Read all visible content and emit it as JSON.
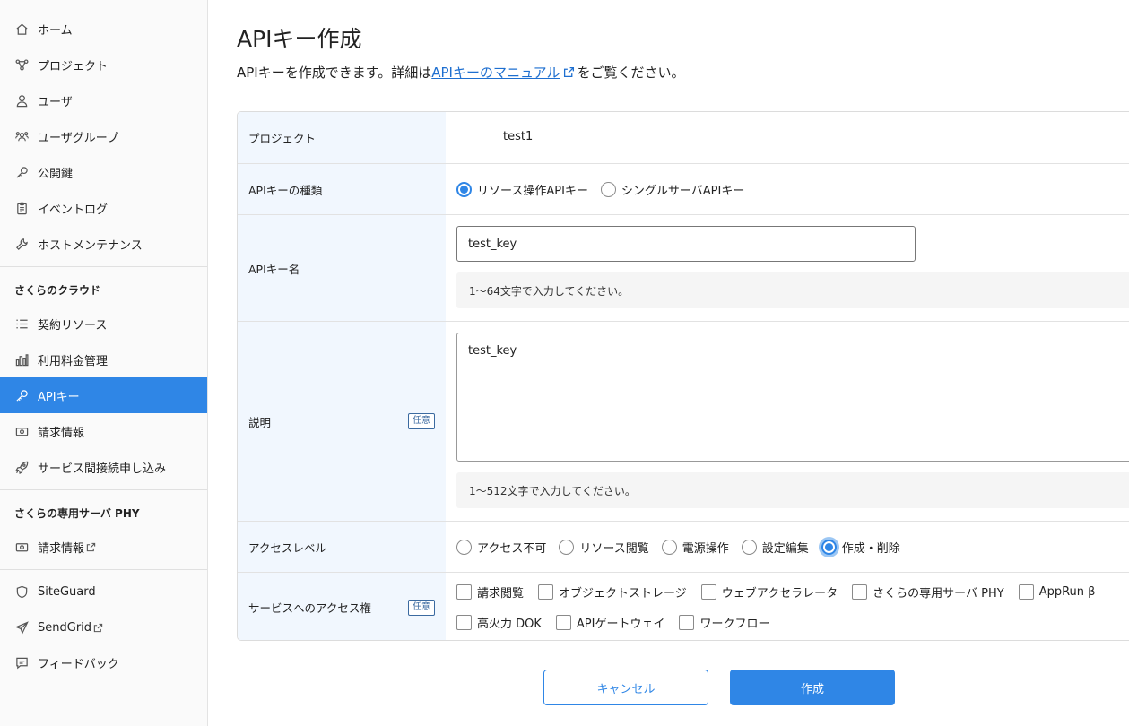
{
  "sidebar": {
    "items": [
      {
        "label": "ホーム",
        "icon": "home-icon"
      },
      {
        "label": "プロジェクト",
        "icon": "project-icon"
      },
      {
        "label": "ユーザ",
        "icon": "user-icon"
      },
      {
        "label": "ユーザグループ",
        "icon": "user-group-icon"
      },
      {
        "label": "公開鍵",
        "icon": "key-icon"
      },
      {
        "label": "イベントログ",
        "icon": "clipboard-icon"
      },
      {
        "label": "ホストメンテナンス",
        "icon": "wrench-icon"
      }
    ],
    "section_cloud": "さくらのクラウド",
    "cloud_items": [
      {
        "label": "契約リソース",
        "icon": "list-icon"
      },
      {
        "label": "利用料金管理",
        "icon": "bar-chart-icon"
      },
      {
        "label": "APIキー",
        "icon": "key-icon",
        "active": true
      },
      {
        "label": "請求情報",
        "icon": "bill-icon"
      },
      {
        "label": "サービス間接続申し込み",
        "icon": "rocket-icon"
      }
    ],
    "section_phy": "さくらの専用サーバ PHY",
    "phy_items": [
      {
        "label": "請求情報",
        "icon": "bill-icon",
        "external": true
      }
    ],
    "bottom_items": [
      {
        "label": "SiteGuard",
        "icon": "shield-icon"
      },
      {
        "label": "SendGrid",
        "icon": "send-icon",
        "external": true
      },
      {
        "label": "フィードバック",
        "icon": "feedback-icon"
      }
    ]
  },
  "page": {
    "title": "APIキー作成",
    "intro_before": "APIキーを作成できます。詳細は",
    "intro_link": "APIキーのマニュアル",
    "intro_after": "をご覧ください。"
  },
  "form": {
    "project_label": "プロジェクト",
    "project_value": "test1",
    "key_type_label": "APIキーの種類",
    "key_type_options": [
      "リソース操作APIキー",
      "シングルサーバAPIキー"
    ],
    "key_type_selected": "リソース操作APIキー",
    "name_label": "APIキー名",
    "name_value": "test_key",
    "name_hint": "1〜64文字で入力してください。",
    "desc_label": "説明",
    "optional_badge": "任意",
    "desc_value": "test_key",
    "desc_hint": "1〜512文字で入力してください。",
    "access_level_label": "アクセスレベル",
    "access_level_options": [
      "アクセス不可",
      "リソース閲覧",
      "電源操作",
      "設定編集",
      "作成・削除"
    ],
    "access_level_selected": "作成・削除",
    "service_access_label": "サービスへのアクセス権",
    "service_row1": [
      "請求閲覧",
      "オブジェクトストレージ",
      "ウェブアクセラレータ",
      "さくらの専用サーバ PHY",
      "AppRun β"
    ],
    "service_row2": [
      "高火力 DOK",
      "APIゲートウェイ",
      "ワークフロー"
    ]
  },
  "buttons": {
    "cancel": "キャンセル",
    "create": "作成"
  },
  "colors": {
    "accent": "#2f86e6",
    "label_bg": "#f1f7fe",
    "link": "#1e6fd0"
  }
}
